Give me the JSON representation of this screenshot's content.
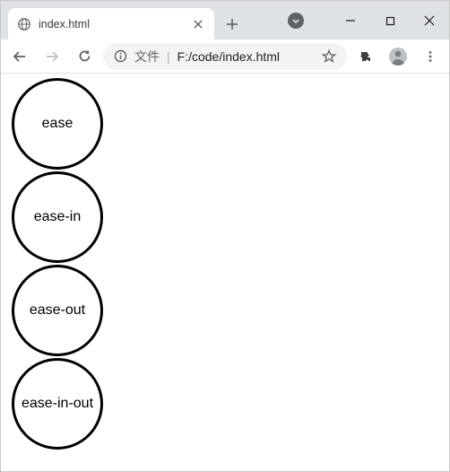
{
  "tab": {
    "title": "index.html"
  },
  "addressbar": {
    "info_label": "文件",
    "url": "F:/code/index.html"
  },
  "circles": {
    "c0": "ease",
    "c1": "ease-in",
    "c2": "ease-out",
    "c3": "ease-in-out"
  }
}
